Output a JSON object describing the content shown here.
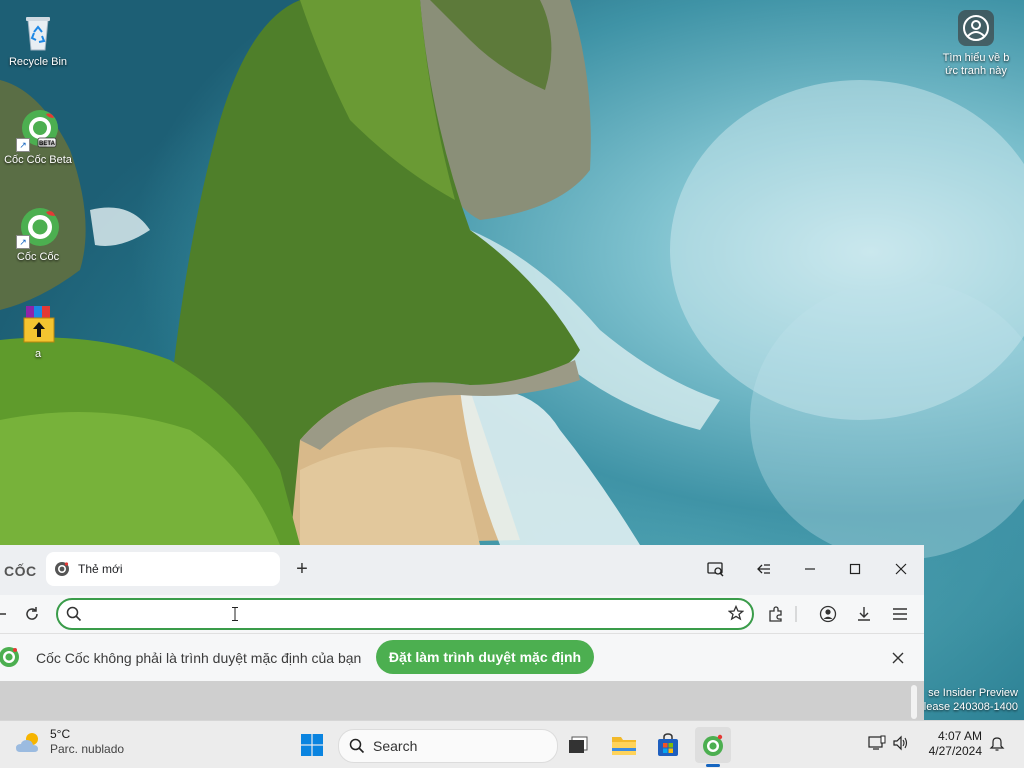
{
  "desktop": {
    "icons": [
      {
        "label": "Recycle Bin",
        "icon": "recycle-bin-icon"
      },
      {
        "label": "Cốc Cốc Beta",
        "icon": "coccoc-beta-icon"
      },
      {
        "label": "Cốc Cốc",
        "icon": "coccoc-icon"
      },
      {
        "label": "a",
        "icon": "winrar-archive-icon"
      }
    ],
    "learn_more": {
      "line1": "Tìm hiểu về b",
      "line2": "ức tranh này",
      "icon": "camera-circle-icon"
    },
    "watermark": {
      "line1": "se Insider Preview",
      "line2": "lease 240308-1400"
    }
  },
  "browser": {
    "brand": "CỐC",
    "tab": {
      "title": "Thẻ mới",
      "icon": "coccoc-icon"
    },
    "new_tab_label": "+",
    "omnibox": {
      "value": "",
      "placeholder": ""
    },
    "infobar": {
      "message": "Cốc Cốc không phải là trình duyệt mặc định của bạn",
      "button": "Đặt làm trình duyệt mặc định"
    },
    "colors": {
      "accent": "#4caf50",
      "omnibox_border": "#3a9c4a"
    }
  },
  "taskbar": {
    "weather": {
      "temp": "5°C",
      "desc": "Parc. nublado",
      "icon": "partly-cloudy-icon"
    },
    "search_label": "Search",
    "clock": {
      "time": "4:07 AM",
      "date": "4/27/2024"
    },
    "accent": "#1565c0"
  }
}
